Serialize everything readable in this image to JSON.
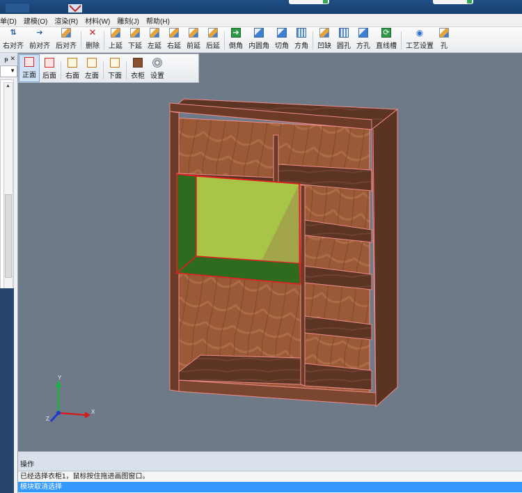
{
  "menu": [
    "单(D)",
    "建模(O)",
    "渲染(R)",
    "材料(W)",
    "雕刻(J)",
    "帮助(H)"
  ],
  "toolbar": [
    {
      "label": "右对齐",
      "icon": "align-right-icon"
    },
    {
      "label": "前对齐",
      "icon": "align-front-icon"
    },
    {
      "label": "后对齐",
      "icon": "align-back-icon"
    },
    {
      "label": "删除",
      "icon": "delete-icon"
    },
    {
      "label": "上延",
      "icon": "extend-up-icon"
    },
    {
      "label": "下延",
      "icon": "extend-down-icon"
    },
    {
      "label": "左延",
      "icon": "extend-left-icon"
    },
    {
      "label": "右延",
      "icon": "extend-right-icon"
    },
    {
      "label": "前延",
      "icon": "extend-front-icon"
    },
    {
      "label": "后延",
      "icon": "extend-back-icon"
    },
    {
      "label": "倒角",
      "icon": "chamfer-icon"
    },
    {
      "label": "内圆角",
      "icon": "inner-fillet-icon"
    },
    {
      "label": "切角",
      "icon": "cut-corner-icon"
    },
    {
      "label": "方角",
      "icon": "square-corner-icon"
    },
    {
      "label": "凹缺",
      "icon": "notch-icon"
    },
    {
      "label": "圆孔",
      "icon": "round-hole-icon"
    },
    {
      "label": "方孔",
      "icon": "square-hole-icon"
    },
    {
      "label": "直线槽",
      "icon": "linear-groove-icon"
    },
    {
      "label": "工艺设置",
      "icon": "process-settings-icon"
    },
    {
      "label": "孔",
      "icon": "hole-icon"
    }
  ],
  "view_toolbar": [
    {
      "label": "正面",
      "icon": "front-view-icon",
      "active": true
    },
    {
      "label": "后面",
      "icon": "back-view-icon",
      "active": false
    },
    {
      "label": "右面",
      "icon": "right-view-icon",
      "active": false
    },
    {
      "label": "左面",
      "icon": "left-view-icon",
      "active": false
    },
    {
      "label": "下面",
      "icon": "bottom-view-icon",
      "active": false
    },
    {
      "label": "衣柜",
      "icon": "wardrobe-icon",
      "active": false
    },
    {
      "label": "设置",
      "icon": "settings-icon",
      "active": false
    }
  ],
  "left_panel": {
    "pin": "ᵽ",
    "close": "✕"
  },
  "axes": {
    "x": "X",
    "y": "Y",
    "z": "Z"
  },
  "operations": {
    "title": "操作",
    "lines": [
      "已经选择衣柜1，鼠标按住拖进画图窗口。",
      "模块取消选择"
    ]
  },
  "colors": {
    "wood": "#8a4f2f",
    "edge": "#f08a8a",
    "selection": "#2e6b1f",
    "highlight_face": "#a8c548",
    "selection_edge": "#e02020"
  }
}
